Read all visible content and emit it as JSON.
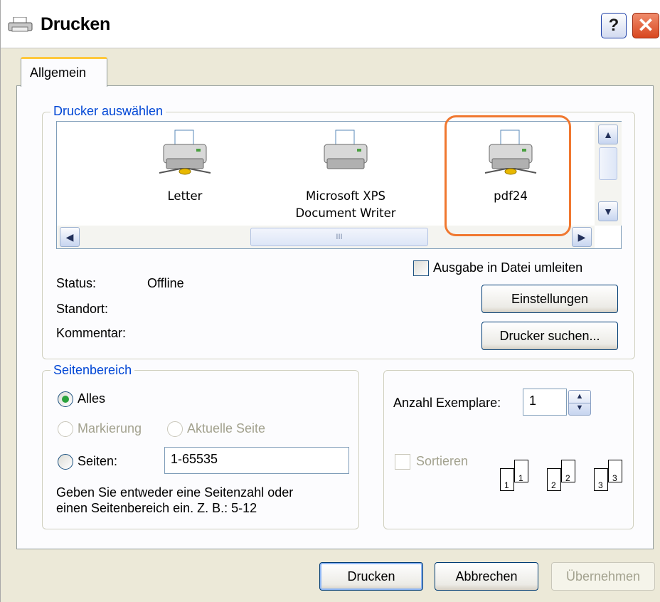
{
  "window": {
    "title": "Drucken",
    "help_label": "?",
    "close_label": "✕"
  },
  "tabs": [
    {
      "label": "Allgemein",
      "active": true
    }
  ],
  "printer_group": {
    "legend": "Drucker auswählen",
    "printers": [
      {
        "name_line1": "Letter",
        "name_line2": ""
      },
      {
        "name_line1": "Microsoft XPS",
        "name_line2": "Document Writer"
      },
      {
        "name_line1": "pdf24",
        "name_line2": "",
        "highlighted": true
      }
    ],
    "scroll_thumb_grip": "III",
    "status_label": "Status:",
    "status_value": "Offline",
    "location_label": "Standort:",
    "location_value": "",
    "comment_label": "Kommentar:",
    "comment_value": "",
    "print_to_file_label": "Ausgabe in Datei umleiten",
    "print_to_file_checked": false,
    "settings_button": "Einstellungen",
    "find_printer_button": "Drucker suchen..."
  },
  "page_range": {
    "legend": "Seitenbereich",
    "all_label": "Alles",
    "selection_label": "Markierung",
    "current_page_label": "Aktuelle Seite",
    "pages_label": "Seiten:",
    "pages_value": "1-65535",
    "hint_line1": "Geben Sie entweder eine Seitenzahl oder",
    "hint_line2": "einen Seitenbereich ein. Z. B.: 5-12",
    "selected": "all"
  },
  "copies": {
    "count_label": "Anzahl Exemplare:",
    "count_value": "1",
    "collate_label": "Sortieren",
    "collate_checked": false,
    "collate_pages": [
      {
        "back": "1",
        "front": "1"
      },
      {
        "back": "2",
        "front": "2"
      },
      {
        "back": "3",
        "front": "3"
      }
    ]
  },
  "footer": {
    "print_button": "Drucken",
    "cancel_button": "Abbrechen",
    "apply_button": "Übernehmen"
  },
  "colors": {
    "accent_blue": "#0046d5",
    "highlight_orange": "#f07830",
    "radio_green": "#2aa23c",
    "dialog_bg": "#ece9d8"
  }
}
